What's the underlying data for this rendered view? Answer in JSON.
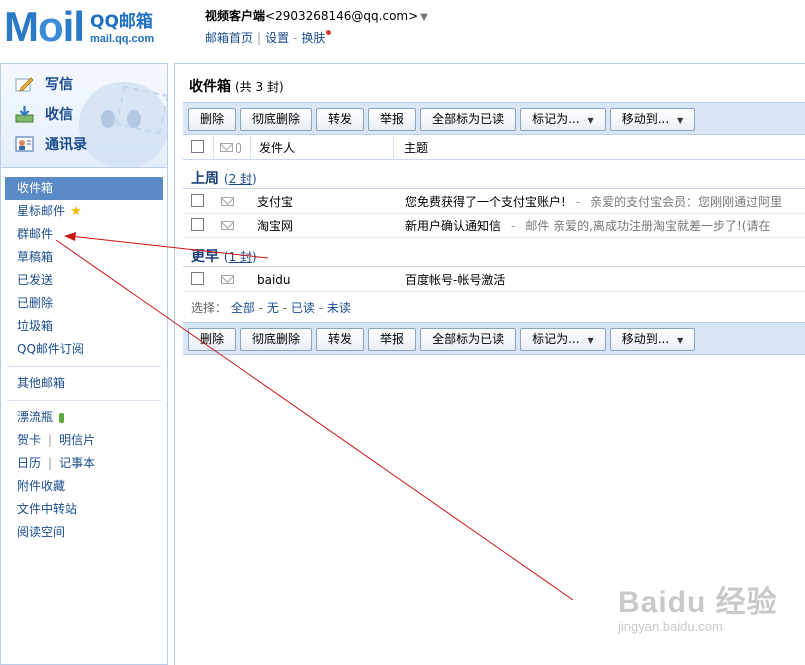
{
  "header": {
    "logo_main": "M",
    "logo_o": "o",
    "logo_il": "il",
    "logo_cn": "QQ邮箱",
    "logo_url": "mail.qq.com",
    "account_name": "视频客户端",
    "account_email": "<2903268146@qq.com>",
    "account_arrow": "▼",
    "links": [
      "邮箱首页",
      "设置",
      "换肤"
    ],
    "link_sep": "|",
    "link_dash": "-"
  },
  "quick_actions": [
    {
      "label": "写信",
      "icon": "pencil-icon"
    },
    {
      "label": "收信",
      "icon": "inbox-download-icon"
    },
    {
      "label": "通讯录",
      "icon": "contacts-icon"
    }
  ],
  "folders": {
    "inbox": "收件箱",
    "starred": "星标邮件",
    "group": "群邮件",
    "drafts": "草稿箱",
    "sent": "已发送",
    "deleted": "已删除",
    "spam": "垃圾箱",
    "subscriptions": "QQ邮件订阅",
    "other": "其他邮箱",
    "bottle": "漂流瓶",
    "card": "贺卡",
    "postcard": "明信片",
    "calendar": "日历",
    "notes": "记事本",
    "attachments": "附件收藏",
    "transfer": "文件中转站",
    "reading": "阅读空间",
    "pipe": "|"
  },
  "main": {
    "title": "收件箱",
    "count": "(共 3 封)",
    "toolbar": {
      "delete": "删除",
      "perm_delete": "彻底删除",
      "forward": "转发",
      "report": "举报",
      "mark_all_read": "全部标为已读",
      "mark_as": "标记为...",
      "move_to": "移动到..."
    },
    "columns": {
      "sender": "发件人",
      "subject": "主题"
    },
    "groups": [
      {
        "label": "上周",
        "open": "(",
        "count": "2 封",
        "close": ")",
        "rows": [
          {
            "sender": "支付宝",
            "subject": "您免费获得了一个支付宝账户!",
            "dash": "-",
            "preview": "亲爱的支付宝会员：您刚刚通过阿里"
          },
          {
            "sender": "淘宝网",
            "subject": "新用户确认通知信",
            "dash": "-",
            "preview": "邮件  亲爱的,离成功注册淘宝就差一步了!(请在"
          }
        ]
      },
      {
        "label": "更早",
        "open": "(",
        "count": "1 封",
        "close": ")",
        "rows": [
          {
            "sender": "baidu",
            "subject": "百度帐号-帐号激活",
            "dash": "",
            "preview": ""
          }
        ]
      }
    ],
    "select_line": {
      "prefix": "选择：",
      "all": "全部",
      "none": "无",
      "read": "已读",
      "unread": "未读",
      "sep": "-"
    }
  },
  "watermark": {
    "big": "Baidu 经验",
    "small": "jingyan.baidu.com"
  },
  "colors": {
    "brand_blue": "#2a78c8",
    "link_blue": "#1a4b8f",
    "active_folder": "#5b8bc5",
    "toolbar_bg": "#d8e6f6",
    "annotation_arrow": "#cc1111"
  }
}
